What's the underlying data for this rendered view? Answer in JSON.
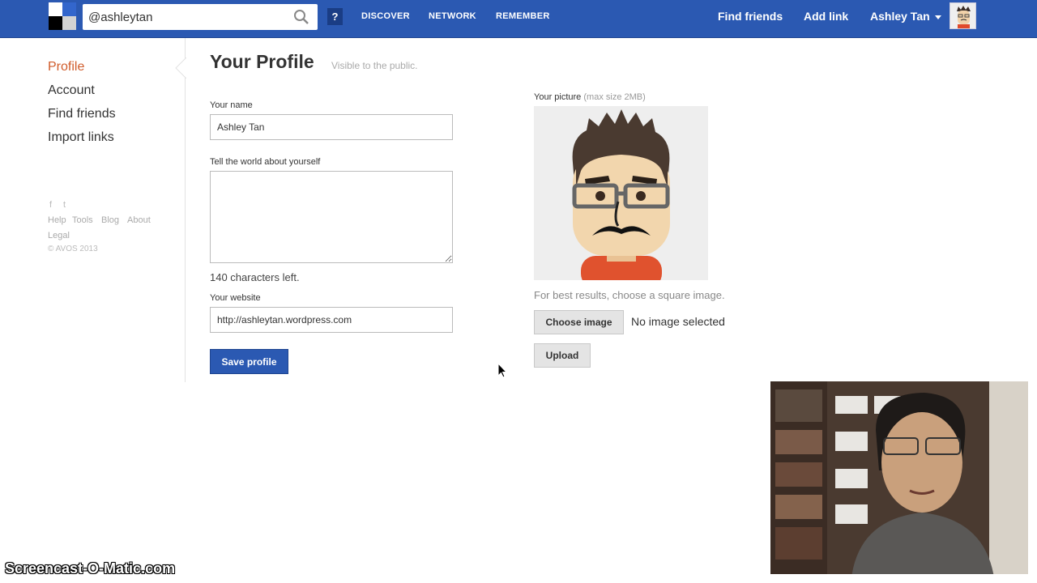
{
  "header": {
    "search_value": "@ashleytan",
    "help_label": "?",
    "nav": [
      "DISCOVER",
      "NETWORK",
      "REMEMBER"
    ],
    "find_friends": "Find friends",
    "add_link": "Add link",
    "user_name": "Ashley Tan"
  },
  "sidebar": {
    "items": [
      "Profile",
      "Account",
      "Find friends",
      "Import links"
    ],
    "active_index": 0,
    "social": [
      "f",
      "t"
    ],
    "footer_links": [
      "Help",
      "Tools",
      "Blog",
      "About",
      "Legal"
    ],
    "copyright": "© AVOS 2013"
  },
  "profile": {
    "title": "Your Profile",
    "subtitle": "Visible to the public.",
    "name_label": "Your name",
    "name_value": "Ashley Tan",
    "bio_label": "Tell the world about yourself",
    "bio_value": "",
    "chars_left": "140 characters left.",
    "website_label": "Your website",
    "website_value": "http://ashleytan.wordpress.com",
    "save_label": "Save profile"
  },
  "picture": {
    "label": "Your picture",
    "label_note": "(max size 2MB)",
    "hint": "For best results, choose a square image.",
    "choose_label": "Choose image",
    "no_image": "No image selected",
    "upload_label": "Upload"
  },
  "overlay": {
    "watermark": "Screencast-O-Matic.com"
  },
  "colors": {
    "header_bg": "#2b59b2",
    "active_link": "#d05c2b",
    "primary_button": "#2b59b2"
  }
}
